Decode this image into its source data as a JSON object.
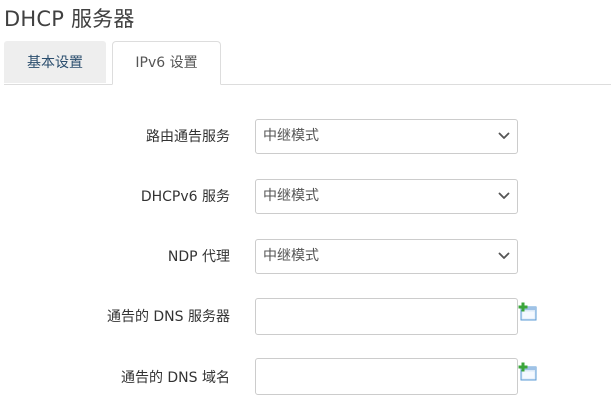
{
  "page": {
    "title": "DHCP 服务器"
  },
  "tabs": [
    {
      "label": "基本设置",
      "active": false
    },
    {
      "label": "IPv6 设置",
      "active": true
    }
  ],
  "form": {
    "router_advert": {
      "label": "路由通告服务",
      "value": "中继模式"
    },
    "dhcpv6": {
      "label": "DHCPv6 服务",
      "value": "中继模式"
    },
    "ndp_proxy": {
      "label": "NDP 代理",
      "value": "中继模式"
    },
    "dns_servers": {
      "label": "通告的 DNS 服务器",
      "value": "",
      "add_icon": "add-entry-icon"
    },
    "dns_domains": {
      "label": "通告的 DNS 域名",
      "value": "",
      "add_icon": "add-entry-icon"
    }
  },
  "colors": {
    "active_tab_bg": "#ffffff",
    "inactive_tab_bg": "#eeeeee",
    "inactive_tab_text": "#2a4d6d",
    "border": "#cccccc",
    "add_icon_green": "#3aa53a",
    "add_icon_blue": "#5b9bd5"
  }
}
